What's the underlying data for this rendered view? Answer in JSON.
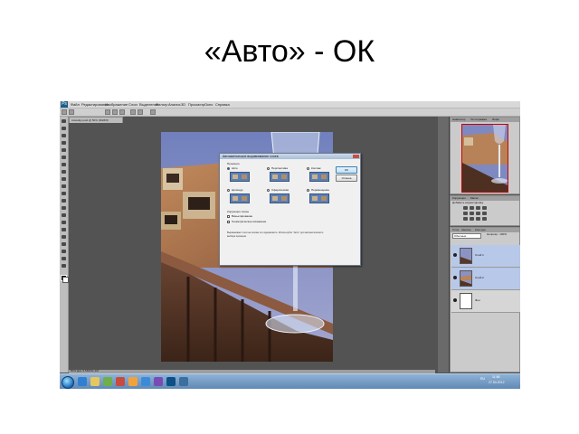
{
  "slide": {
    "title": "«Авто» - ОК"
  },
  "app": {
    "logo": "Ps",
    "menu": [
      "Файл",
      "Редактирование",
      "Изображение",
      "Слои",
      "Выделение",
      "Фильтр",
      "Анализ",
      "3D",
      "Просмотр",
      "Окно",
      "Справка"
    ],
    "document_tab": "Autoalign.psd @ 50% (RGB/8)",
    "status": "50%   Док: 5,54M/11,1M"
  },
  "dialog": {
    "title": "Автоматическое выравнивание слоев",
    "projection_label": "Проекция",
    "options": [
      {
        "label": "Авто",
        "selected": true
      },
      {
        "label": "Перспектива",
        "selected": false
      },
      {
        "label": "Коллаж",
        "selected": false
      },
      {
        "label": "Цилиндр",
        "selected": false
      },
      {
        "label": "Сферическая",
        "selected": false
      },
      {
        "label": "Перемещение",
        "selected": false
      }
    ],
    "lens_label": "Коррекция линзы",
    "checks": [
      "Виньетирование",
      "Геометрическое искажение"
    ],
    "note": "Выравнивает слои на основе их содержимого. Используйте \"Авто\" для автоматического выбора проекции.",
    "ok_label": "OK",
    "cancel_label": "Отмена"
  },
  "panels": {
    "navigator_tabs": [
      "Навигатор",
      "Гистограмма",
      "Инфо"
    ],
    "adjustments_tabs": [
      "Коррекция",
      "Маски"
    ],
    "adjustments_hint": "Добавить корректировку",
    "layers_tabs": [
      "Слои",
      "Каналы",
      "Контуры"
    ],
    "blend_mode": "Обычные",
    "opacity": "Непрозр.: 100%",
    "layers": [
      {
        "name": "Слой 1",
        "selected": true
      },
      {
        "name": "Слой 2",
        "selected": true
      },
      {
        "name": "Фон",
        "selected": false
      }
    ]
  },
  "taskbar": {
    "time": "11:56",
    "date": "27.04.2012",
    "lang": "RU"
  }
}
